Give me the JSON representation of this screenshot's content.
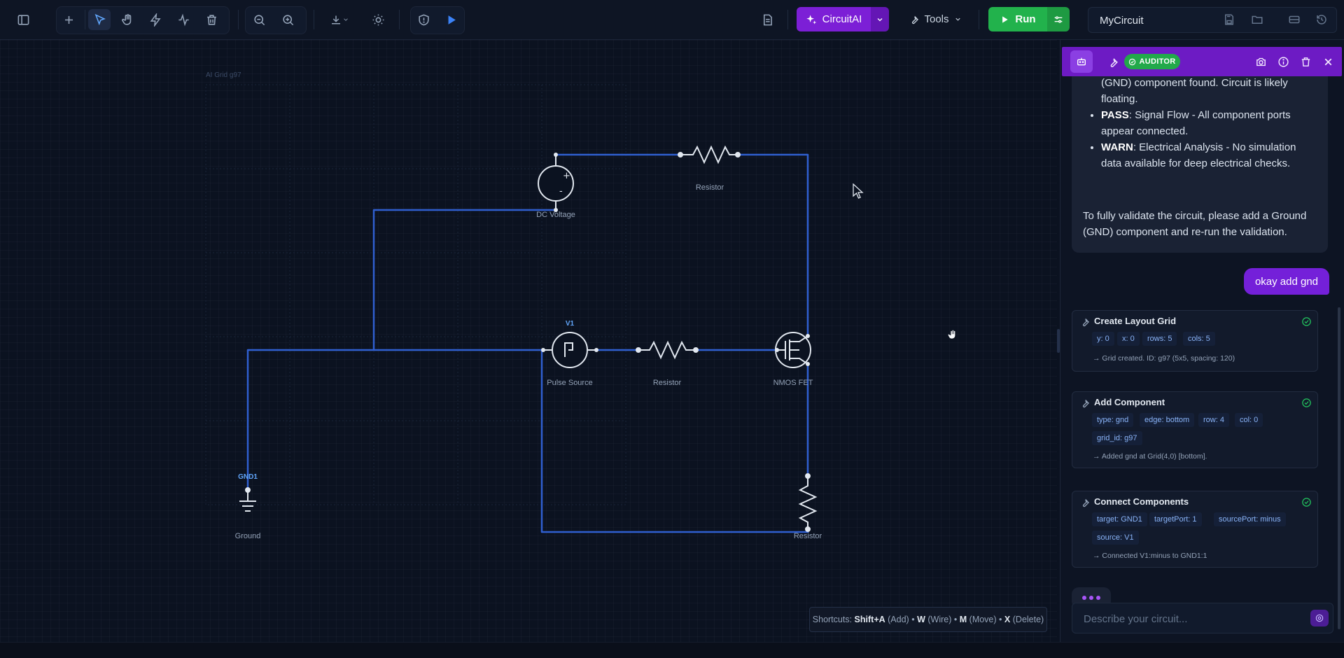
{
  "toolbar": {
    "ai_button_label": "CircuitAI",
    "tools_label": "Tools",
    "run_label": "Run",
    "circuit_name": "MyCircuit"
  },
  "canvas": {
    "grid_label": "AI Grid g97",
    "components": {
      "dc_voltage": "DC Voltage",
      "resistor_top": "Resistor",
      "pulse_source_id": "V1",
      "pulse_source": "Pulse Source",
      "resistor_mid": "Resistor",
      "nmos": "NMOS FET",
      "ground_id": "GND1",
      "ground": "Ground",
      "resistor_bottom": "Resistor"
    },
    "shortcuts": {
      "prefix": "Shortcuts:",
      "k1": "Shift+A",
      "d1": "(Add)",
      "k2": "W",
      "d2": "(Wire)",
      "k3": "M",
      "d3": "(Move)",
      "k4": "X",
      "d4": "(Delete)",
      "sep": "•"
    }
  },
  "panel": {
    "badge": "AUDITOR",
    "ai_message": {
      "line_continued": "(GND) component found. Circuit is likely floating.",
      "items": [
        {
          "status": "PASS",
          "text": ": Signal Flow - All component ports appear connected."
        },
        {
          "status": "WARN",
          "text": ": Electrical Analysis - No simulation data available for deep electrical checks."
        }
      ],
      "closing": "To fully validate the circuit, please add a Ground (GND) component and re-run the validation."
    },
    "user_message": "okay add gnd",
    "tool_calls": [
      {
        "title": "Create Layout Grid",
        "params": [
          "y: 0",
          "x: 0",
          "rows: 5",
          "cols: 5"
        ],
        "result": "→ Grid created. ID: g97 (5x5, spacing: 120)"
      },
      {
        "title": "Add Component",
        "params": [
          "type: gnd",
          "edge: bottom",
          "row: 4",
          "col: 0",
          "grid_id: g97"
        ],
        "result": "→ Added gnd at Grid(4,0) [bottom]."
      },
      {
        "title": "Connect Components",
        "params": [
          "target: GND1",
          "targetPort: 1",
          "sourcePort: minus",
          "source: V1"
        ],
        "result": "→ Connected V1:minus to GND1:1"
      }
    ],
    "input_placeholder": "Describe your circuit..."
  },
  "colors": {
    "background": "#0b1220",
    "wire": "#2f5fd0",
    "accent_purple": "#7c1fd6",
    "run_green": "#22b24c",
    "auditor_green": "#22a94b"
  }
}
